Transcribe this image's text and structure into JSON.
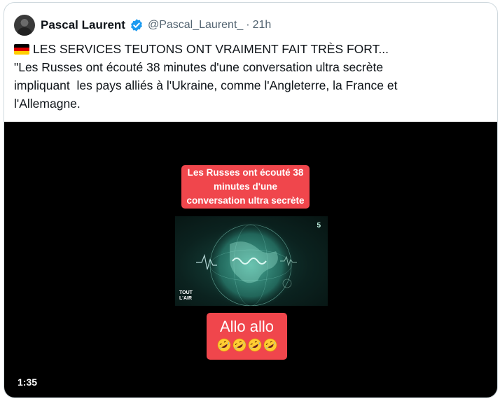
{
  "tweet": {
    "author": {
      "display_name": "Pascal Laurent",
      "handle": "@Pascal_Laurent_",
      "separator": "·",
      "time": "21h",
      "verified": true
    },
    "flag_icon": "germany-flag-icon",
    "text_lines": [
      "LES SERVICES TEUTONS ONT VRAIMENT FAIT TRÈS FORT...",
      "\"Les Russes ont écouté 38 minutes d'une conversation ultra secrète",
      "impliquant  les pays alliés à l'Ukraine, comme l'Angleterre, la France et",
      "l'Allemagne."
    ],
    "media": {
      "caption_lines": [
        "Les Russes ont écouté 38",
        "minutes d'une",
        "conversation ultra secrète"
      ],
      "frame_number": "5",
      "logo_lines": [
        "TOUT",
        "L'AIR"
      ],
      "allo_text": "Allo allo",
      "emoji_icon": "rolling-on-floor-laughing-icon",
      "emoji_count": 4,
      "duration": "1:35"
    }
  },
  "colors": {
    "accent_red": "#f0464c",
    "verified_blue": "#1d9bf0",
    "muted_text": "#536471",
    "border": "#cfd9de"
  }
}
